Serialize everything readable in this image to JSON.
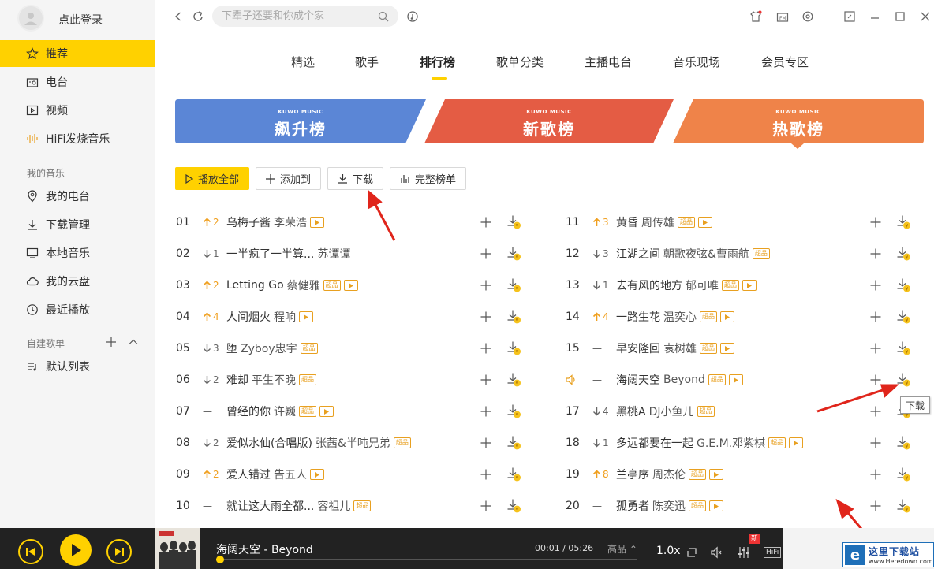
{
  "sidebar": {
    "login": "点此登录",
    "items": [
      {
        "label": "推荐",
        "icon": "star-icon",
        "active": true
      },
      {
        "label": "电台",
        "icon": "radio-icon"
      },
      {
        "label": "视频",
        "icon": "video-icon"
      },
      {
        "label": "HiFi发烧音乐",
        "icon": "hifi-icon"
      }
    ],
    "my_music_title": "我的音乐",
    "my_music": [
      {
        "label": "我的电台",
        "icon": "location-icon"
      },
      {
        "label": "下载管理",
        "icon": "download-icon"
      },
      {
        "label": "本地音乐",
        "icon": "monitor-icon"
      },
      {
        "label": "我的云盘",
        "icon": "cloud-icon"
      },
      {
        "label": "最近播放",
        "icon": "clock-icon"
      }
    ],
    "playlist_title": "自建歌单",
    "playlists": [
      {
        "label": "默认列表",
        "icon": "list-icon"
      }
    ]
  },
  "topbar": {
    "search_placeholder": "下辈子还要和你成个家"
  },
  "tabs": [
    "精选",
    "歌手",
    "排行榜",
    "歌单分类",
    "主播电台",
    "音乐现场",
    "会员专区"
  ],
  "active_tab": "排行榜",
  "banners": [
    {
      "brand": "KUWO MUSIC",
      "title": "飙升榜",
      "color": "#5b86d6"
    },
    {
      "brand": "KUWO MUSIC",
      "title": "新歌榜",
      "color": "#e45c44"
    },
    {
      "brand": "KUWO MUSIC",
      "title": "热歌榜",
      "color": "#ef8349"
    }
  ],
  "buttons": {
    "play_all": "播放全部",
    "add_to": "添加到",
    "download": "下载",
    "full_list": "完整榜单"
  },
  "songs": [
    {
      "rank": "01",
      "trend": "up",
      "change": "2",
      "title": "乌梅子酱",
      "artist": "李荣浩",
      "hq": false,
      "mv": true
    },
    {
      "rank": "02",
      "trend": "down",
      "change": "1",
      "title": "一半疯了一半算...",
      "artist": "苏谭谭",
      "hq": false,
      "mv": false
    },
    {
      "rank": "03",
      "trend": "up",
      "change": "2",
      "title": "Letting Go",
      "artist": "蔡健雅",
      "hq": true,
      "mv": true
    },
    {
      "rank": "04",
      "trend": "up",
      "change": "4",
      "title": "人间烟火",
      "artist": "程响",
      "hq": false,
      "mv": true
    },
    {
      "rank": "05",
      "trend": "down",
      "change": "3",
      "title": "堕",
      "artist": "Zyboy忠宇",
      "hq": true,
      "mv": false
    },
    {
      "rank": "06",
      "trend": "down",
      "change": "2",
      "title": "难却",
      "artist": "平生不晚",
      "hq": true,
      "mv": false
    },
    {
      "rank": "07",
      "trend": "same",
      "change": "",
      "title": "曾经的你",
      "artist": "许巍",
      "hq": true,
      "mv": true
    },
    {
      "rank": "08",
      "trend": "down",
      "change": "2",
      "title": "爱似水仙(合唱版)",
      "artist": "张茜&半吨兄弟",
      "hq": true,
      "mv": false
    },
    {
      "rank": "09",
      "trend": "up",
      "change": "2",
      "title": "爱人错过",
      "artist": "告五人",
      "hq": false,
      "mv": true
    },
    {
      "rank": "10",
      "trend": "same",
      "change": "",
      "title": "就让这大雨全都...",
      "artist": "容祖儿",
      "hq": true,
      "mv": false
    },
    {
      "rank": "11",
      "trend": "up",
      "change": "3",
      "title": "黄昏",
      "artist": "周传雄",
      "hq": true,
      "mv": true
    },
    {
      "rank": "12",
      "trend": "down",
      "change": "3",
      "title": "江湖之间",
      "artist": "朝歌夜弦&曹雨航",
      "hq": true,
      "mv": false
    },
    {
      "rank": "13",
      "trend": "down",
      "change": "1",
      "title": "去有风的地方",
      "artist": "郁可唯",
      "hq": true,
      "mv": true
    },
    {
      "rank": "14",
      "trend": "up",
      "change": "4",
      "title": "一路生花",
      "artist": "温奕心",
      "hq": true,
      "mv": true
    },
    {
      "rank": "15",
      "trend": "same",
      "change": "",
      "title": "早安隆回",
      "artist": "袁树雄",
      "hq": true,
      "mv": true
    },
    {
      "rank": "playing",
      "trend": "same",
      "change": "",
      "title": "海阔天空",
      "artist": "Beyond",
      "hq": true,
      "mv": true
    },
    {
      "rank": "17",
      "trend": "down",
      "change": "4",
      "title": "黑桃A",
      "artist": "DJ小鱼儿",
      "hq": true,
      "mv": false
    },
    {
      "rank": "18",
      "trend": "down",
      "change": "1",
      "title": "多远都要在一起",
      "artist": "G.E.M.邓紫棋",
      "hq": true,
      "mv": true
    },
    {
      "rank": "19",
      "trend": "up",
      "change": "8",
      "title": "兰亭序",
      "artist": "周杰伦",
      "hq": true,
      "mv": true
    },
    {
      "rank": "20",
      "trend": "same",
      "change": "",
      "title": "孤勇者",
      "artist": "陈奕迅",
      "hq": true,
      "mv": true
    }
  ],
  "tags": {
    "hq": "超品",
    "same": "—"
  },
  "tooltip": "下载",
  "player": {
    "title": "海阔天空 - Beyond",
    "time": "00:01 / 05:26",
    "quality": "高品",
    "speed": "1.0x",
    "progress": 0.005,
    "new_badge": "新",
    "hifi": "HiFi"
  },
  "watermark": {
    "line1": "这里下载站",
    "line2": "www.Heredown.com"
  },
  "colors": {
    "accent": "#ffd100",
    "tag": "#e8a020",
    "player_bg": "#222222"
  }
}
